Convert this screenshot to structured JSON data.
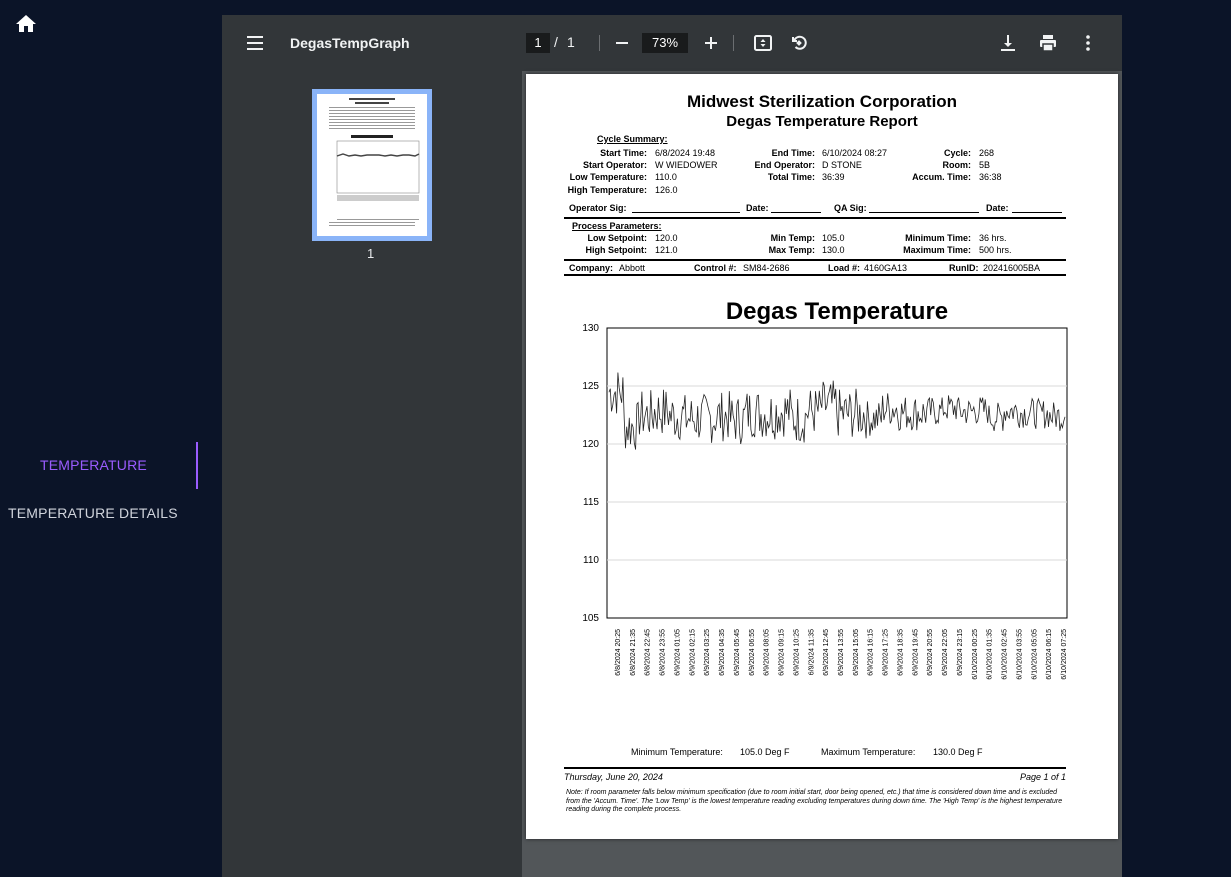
{
  "app": {
    "nav": {
      "temperature": "TEMPERATURE",
      "temperature_details": "TEMPERATURE DETAILS"
    },
    "accent_color": "#9a5cff"
  },
  "viewer": {
    "title": "DegasTempGraph",
    "page_current": "1",
    "page_sep": "/",
    "page_total": "1",
    "zoom": "73%",
    "thumbnail_label": "1"
  },
  "report": {
    "company_name": "Midwest Sterilization Corporation",
    "report_title": "Degas Temperature Report",
    "cycle_summary_heading": "Cycle Summary:",
    "start_time_label": "Start Time:",
    "start_time": "6/8/2024 19:48",
    "start_operator_label": "Start Operator:",
    "start_operator": "W WIEDOWER",
    "low_temperature_label": "Low Temperature:",
    "low_temperature": "110.0",
    "high_temperature_label": "High Temperature:",
    "high_temperature": "126.0",
    "end_time_label": "End Time:",
    "end_time": "6/10/2024 08:27",
    "end_operator_label": "End Operator:",
    "end_operator": "D STONE",
    "total_time_label": "Total Time:",
    "total_time": "36:39",
    "cycle_label": "Cycle:",
    "cycle": "268",
    "room_label": "Room:",
    "room": "5B",
    "accum_time_label": "Accum. Time:",
    "accum_time": "36:38",
    "operator_sig_label": "Operator Sig:",
    "date_label": "Date:",
    "qa_sig_label": "QA Sig:",
    "process_params_heading": "Process Parameters:",
    "low_setpoint_label": "Low Setpoint:",
    "low_setpoint": "120.0",
    "high_setpoint_label": "High Setpoint:",
    "high_setpoint": "121.0",
    "min_temp_label": "Min Temp:",
    "min_temp": "105.0",
    "max_temp_label": "Max Temp:",
    "max_temp": "130.0",
    "minimum_time_label": "Minimum Time:",
    "minimum_time": "36 hrs.",
    "maximum_time_label": "Maximum Time:",
    "maximum_time": "500 hrs.",
    "company_label": "Company:",
    "company": "Abbott",
    "control_label": "Control #:",
    "control": "SM84-2686",
    "load_label": "Load #:",
    "load": "4160GA13",
    "runid_label": "RunID:",
    "runid": "202416005BA",
    "min_temperature_footer_label": "Minimum Temperature:",
    "min_temperature_footer": "105.0 Deg F",
    "max_temperature_footer_label": "Maximum Temperature:",
    "max_temperature_footer": "130.0 Deg F",
    "print_date": "Thursday, June 20, 2024",
    "page_of": "Page 1 of 1",
    "note": "Note:  If room parameter falls below minimum specification (due to room initial start, door being opened, etc.) that time is considered down time and is excluded from the 'Accum. Time'. The 'Low Temp' is the lowest temperature reading excluding temperatures during down time. The 'High Temp' is the highest temperature reading during the complete process."
  },
  "chart_data": {
    "type": "line",
    "title": "Degas Temperature",
    "xlabel": "",
    "ylabel": "",
    "ylim": [
      105,
      130
    ],
    "yticks": [
      105,
      110,
      115,
      120,
      125,
      130
    ],
    "grid": true,
    "x": [
      "6/8/2024 20:25",
      "6/8/2024 21:35",
      "6/8/2024 22:45",
      "6/8/2024 23:55",
      "6/9/2024 01:05",
      "6/9/2024 02:15",
      "6/9/2024 03:25",
      "6/9/2024 04:35",
      "6/9/2024 05:45",
      "6/9/2024 06:55",
      "6/9/2024 08:05",
      "6/9/2024 09:15",
      "6/9/2024 10:25",
      "6/9/2024 11:35",
      "6/9/2024 12:45",
      "6/9/2024 13:55",
      "6/9/2024 15:05",
      "6/9/2024 16:15",
      "6/9/2024 17:25",
      "6/9/2024 18:35",
      "6/9/2024 19:45",
      "6/9/2024 20:55",
      "6/9/2024 22:05",
      "6/9/2024 23:15",
      "6/10/2024 00:25",
      "6/10/2024 01:35",
      "6/10/2024 02:45",
      "6/10/2024 03:55",
      "6/10/2024 05:05",
      "6/10/2024 06:15",
      "6/10/2024 07:25"
    ],
    "series": [
      {
        "values": [
          124.5,
          121.5,
          122.5,
          122.8,
          122.4,
          122.2,
          122.2,
          122.4,
          122.1,
          122.7,
          122.6,
          122.8,
          122.2,
          122.8,
          123.3,
          122.6,
          122.6,
          122.2,
          123.1,
          122.7,
          122.7,
          122.8,
          123.1,
          122.8,
          122.9,
          122.3,
          122.9,
          122.7,
          122.6,
          122.4,
          123.5
        ]
      }
    ]
  }
}
